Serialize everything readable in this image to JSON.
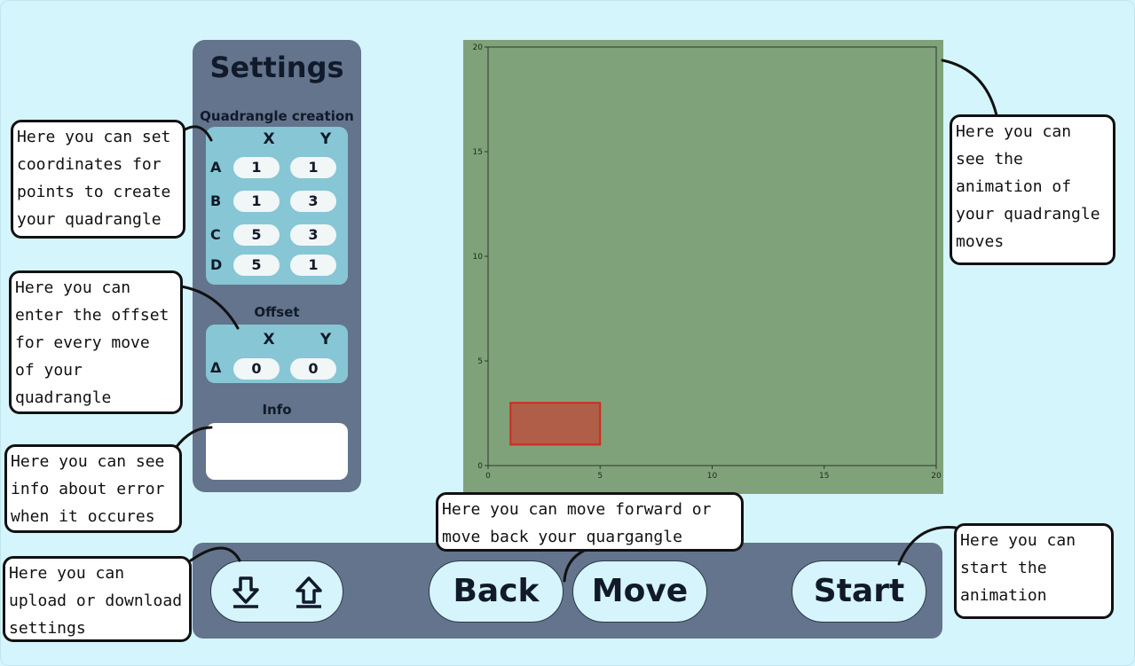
{
  "settings": {
    "title": "Settings",
    "quadrangle_label": "Quadrangle creation",
    "col_x": "X",
    "col_y": "Y",
    "points": [
      {
        "name": "A",
        "x": "1",
        "y": "1"
      },
      {
        "name": "B",
        "x": "1",
        "y": "3"
      },
      {
        "name": "C",
        "x": "5",
        "y": "3"
      },
      {
        "name": "D",
        "x": "5",
        "y": "1"
      }
    ],
    "offset_label": "Offset",
    "offset": {
      "name": "Δ",
      "x": "0",
      "y": "0"
    },
    "info_label": "Info",
    "info_text": ""
  },
  "plot": {
    "x_ticks": [
      "0",
      "5",
      "10",
      "15",
      "20"
    ],
    "y_ticks": [
      "0",
      "5",
      "10",
      "15",
      "20"
    ],
    "xlim": [
      0,
      20
    ],
    "ylim": [
      0,
      20
    ],
    "background": "#80a27a",
    "quad": {
      "points": [
        [
          1,
          1
        ],
        [
          1,
          3
        ],
        [
          5,
          3
        ],
        [
          5,
          1
        ]
      ],
      "fill": "#b05e48",
      "stroke": "#d02a1e"
    }
  },
  "buttons": {
    "download_icon": "download-arrow-icon",
    "upload_icon": "upload-arrow-icon",
    "back": "Back",
    "move": "Move",
    "start": "Start"
  },
  "callouts": {
    "coords": "Here you can set\ncoordinates for\npoints to create\nyour quadrangle",
    "offset": "Here you can\nenter the offset\nfor every move\nof your\nquadrangle",
    "info": "Here you can see\ninfo about error\nwhen it occures",
    "io": "Here you can\nupload or download\nsettings",
    "move": "Here you can move forward or\nmove back your quargangle",
    "animation": "Here you can\nsee the\nanimation of\nyour quadrangle\nmoves",
    "start": "Here you can\nstart the\nanimation"
  }
}
